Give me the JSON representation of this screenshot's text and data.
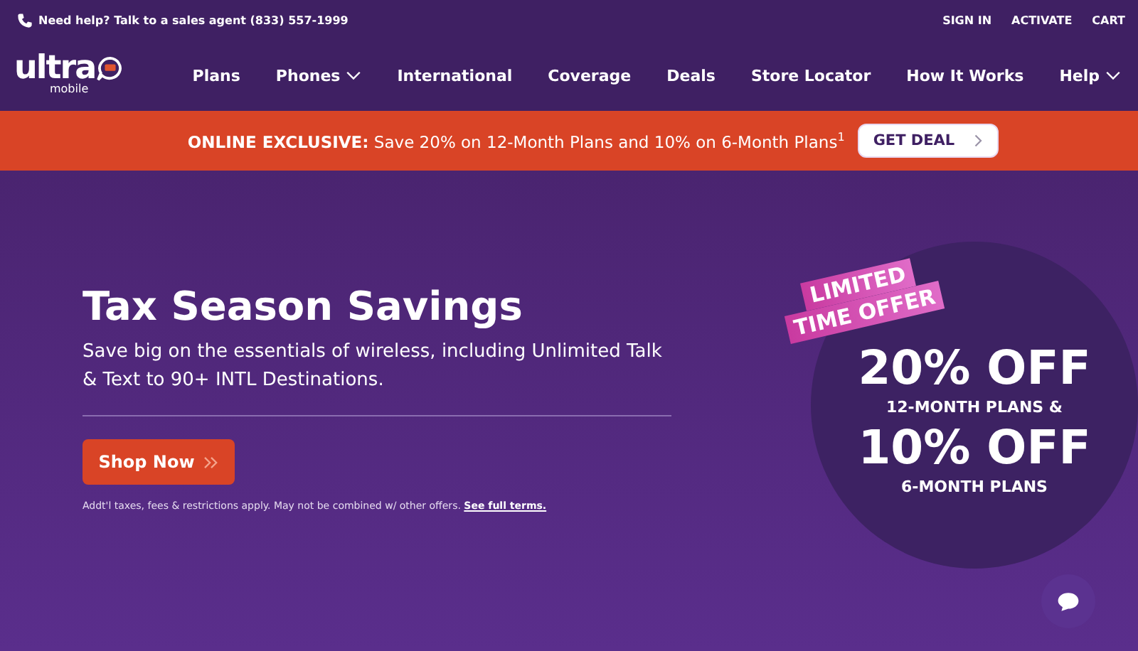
{
  "top_bar": {
    "help_text": "Need help? Talk to a sales agent (833) 557-1999",
    "links": [
      "SIGN IN",
      "ACTIVATE",
      "CART"
    ]
  },
  "logo": {
    "wordmark": "ultra",
    "subtext": "mobile"
  },
  "nav": [
    {
      "label": "Plans",
      "dropdown": false
    },
    {
      "label": "Phones",
      "dropdown": true
    },
    {
      "label": "International",
      "dropdown": false
    },
    {
      "label": "Coverage",
      "dropdown": false
    },
    {
      "label": "Deals",
      "dropdown": false
    },
    {
      "label": "Store Locator",
      "dropdown": false
    },
    {
      "label": "How It Works",
      "dropdown": false
    },
    {
      "label": "Help",
      "dropdown": true
    }
  ],
  "promo_banner": {
    "text": "**ONLINE EXCLUSIVE:** Save 20% on 12-Month Plans and 10% on 6-Month Plans$^{1}$",
    "button": "GET DEAL"
  },
  "hero": {
    "title": "Tax Season Savings",
    "subtitle": "Save big on the essentials of wireless, including Unlimited Talk & Text to 90+ INTL Destinations.",
    "button": "Shop Now",
    "fine_print": "Addt'l taxes, fees & restrictions apply. May not be combined w/ other offers.",
    "terms_link": "See full terms."
  },
  "offer": {
    "ribbon": [
      "LIMITED",
      "TIME OFFER"
    ],
    "lines": [
      {
        "kind": "big",
        "text": "20% OFF"
      },
      {
        "kind": "small",
        "text": "12-MONTH PLANS &"
      },
      {
        "kind": "big",
        "text": "10% OFF"
      },
      {
        "kind": "small",
        "text": "6-MONTH PLANS"
      }
    ]
  }
}
